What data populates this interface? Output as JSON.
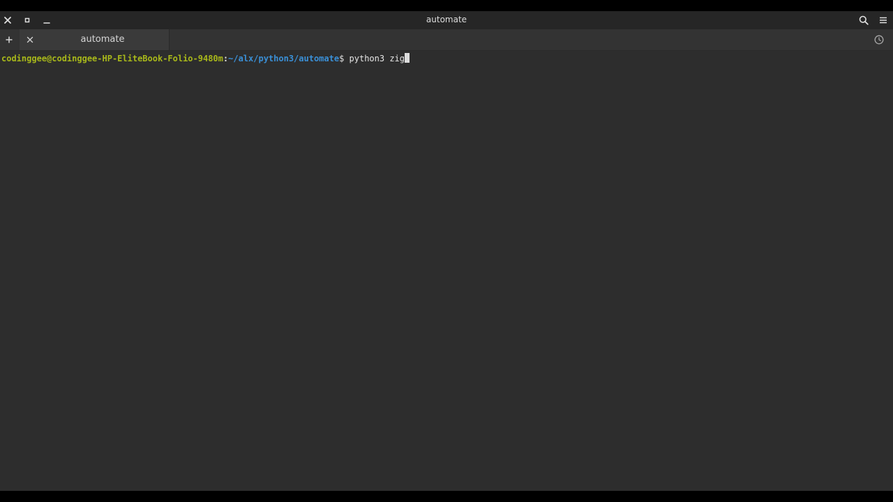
{
  "window": {
    "title": "automate"
  },
  "titlebar": {
    "close_icon": "close-icon",
    "maximize_icon": "maximize-icon",
    "minimize_icon": "minimize-icon",
    "search_icon": "search-icon",
    "menu_icon": "hamburger-menu-icon"
  },
  "tabs": [
    {
      "label": "automate",
      "active": true
    }
  ],
  "tabbar": {
    "add_icon": "plus-icon",
    "history_icon": "clock-icon"
  },
  "terminal": {
    "user_host": "codinggee@codinggee-HP-EliteBook-Folio-9480m",
    "separator": ":",
    "path": "~/alx/python3/automate",
    "prompt_symbol": "$ ",
    "command": "python3 zig"
  },
  "colors": {
    "background": "#2d2d2d",
    "user_host": "#a8b81a",
    "path": "#3a8fd6",
    "text": "#e6e6e6"
  }
}
